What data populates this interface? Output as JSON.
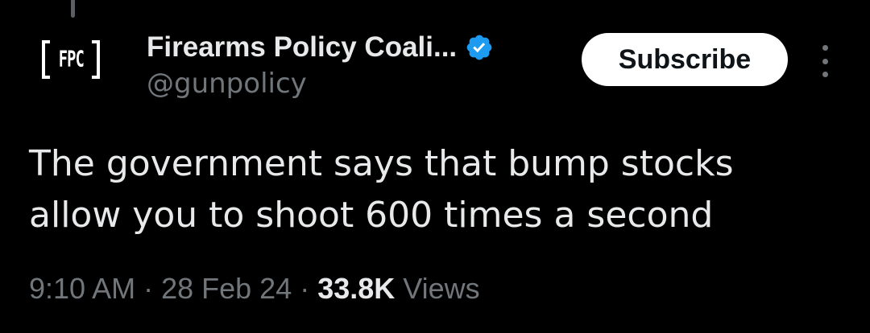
{
  "author": {
    "logo_text": "FPC",
    "display_name": "Firearms Policy Coali...",
    "handle": "@gunpolicy",
    "verified": true
  },
  "actions": {
    "subscribe_label": "Subscribe",
    "more_icon": "more-vertical-icon"
  },
  "tweet": {
    "line1": "The government says that bump stocks",
    "line2": "allow you to shoot 600 times a second"
  },
  "meta": {
    "time": "9:10 AM",
    "separator": "·",
    "date": "28 Feb 24",
    "views_count": "33.8K",
    "views_label": "Views"
  },
  "colors": {
    "background": "#000000",
    "text_primary": "#e7e9ea",
    "text_secondary": "#71767b",
    "verified_blue": "#1d9bf0",
    "button_bg": "#ffffff"
  }
}
